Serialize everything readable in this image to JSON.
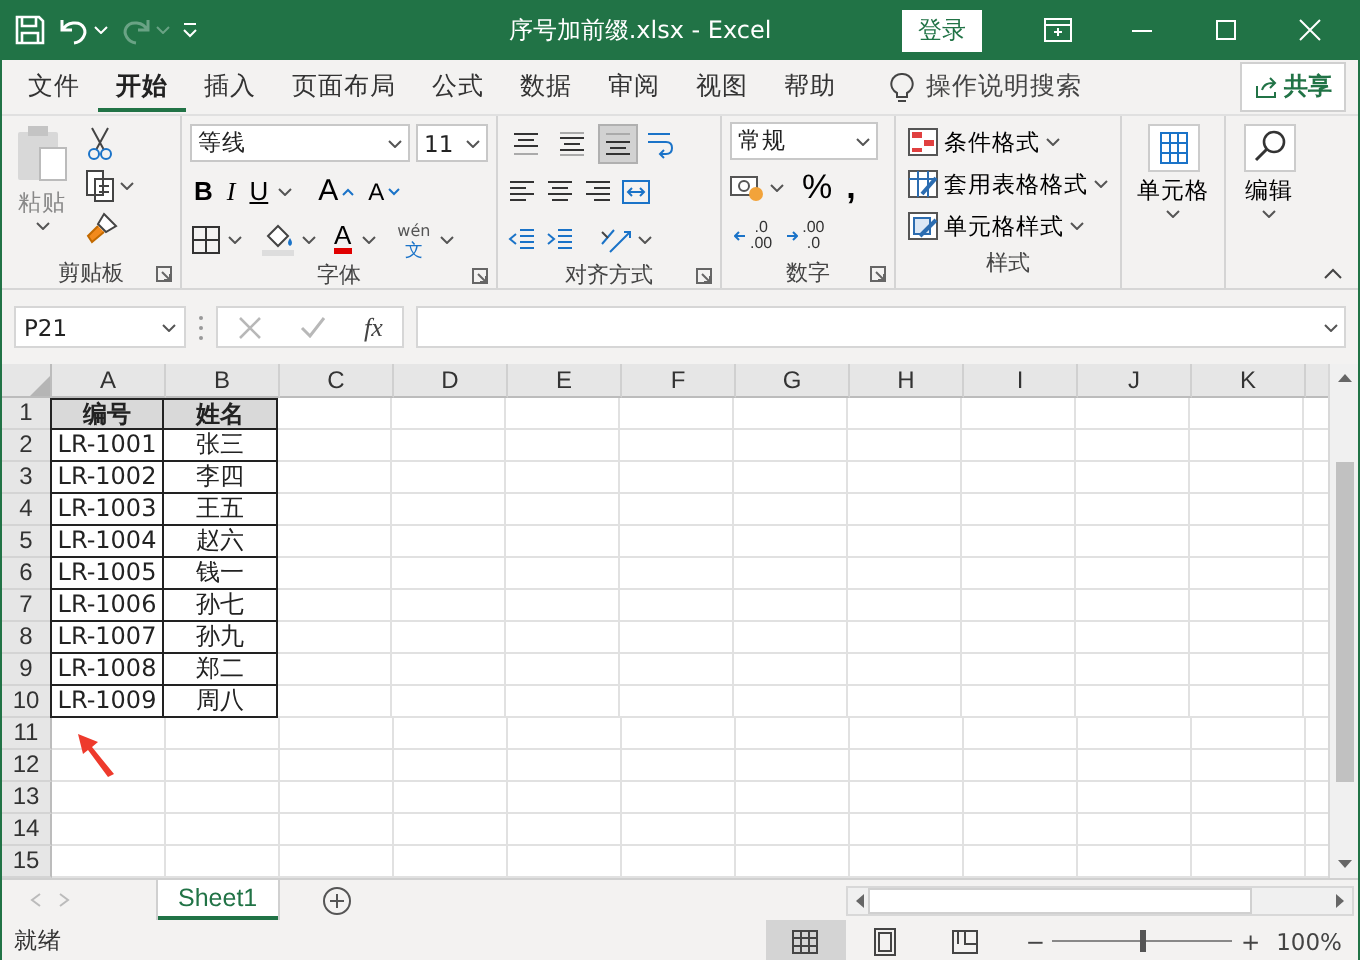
{
  "title_bar": {
    "title": "序号加前缀.xlsx  -  Excel",
    "login": "登录"
  },
  "quick_access": [
    {
      "kind": "save",
      "disabled": false
    },
    {
      "kind": "undo",
      "disabled": false
    },
    {
      "kind": "redo",
      "disabled": true
    }
  ],
  "menu_tabs": [
    {
      "label": "文件",
      "selected": false
    },
    {
      "label": "开始",
      "selected": true
    },
    {
      "label": "插入",
      "selected": false
    },
    {
      "label": "页面布局",
      "selected": false
    },
    {
      "label": "公式",
      "selected": false
    },
    {
      "label": "数据",
      "selected": false
    },
    {
      "label": "审阅",
      "selected": false
    },
    {
      "label": "视图",
      "selected": false
    },
    {
      "label": "帮助",
      "selected": false
    }
  ],
  "tell_me": "操作说明搜索",
  "share": "共享",
  "ribbon": {
    "paste": "粘贴",
    "font_name": "等线",
    "font_size": "11",
    "bold": "B",
    "italic": "I",
    "underline": "U",
    "grow_font": "A",
    "shrink_font": "A",
    "font_color": "A",
    "phonetic": [
      "wén",
      "文"
    ],
    "vertical_align": [
      {
        "kind": "top",
        "selected": false
      },
      {
        "kind": "middle",
        "selected": false
      },
      {
        "kind": "bottom",
        "selected": true
      }
    ],
    "number_format": "常规",
    "percent": "%",
    "comma": ",",
    "increase_decimal": [
      ".0",
      ".00"
    ],
    "decrease_decimal": [
      ".00",
      ".0"
    ],
    "styles": [
      {
        "kind": "conditional",
        "label": "条件格式"
      },
      {
        "kind": "table",
        "label": "套用表格格式"
      },
      {
        "kind": "cell",
        "label": "单元格样式"
      }
    ],
    "cells": "单元格",
    "editing": "编辑",
    "groups": [
      "剪贴板",
      "字体",
      "对齐方式",
      "数字",
      "样式"
    ]
  },
  "formula_bar": {
    "name_box": "P21",
    "fx": "fx",
    "buttons": [
      {
        "kind": "cancel",
        "disabled": true
      },
      {
        "kind": "enter",
        "disabled": true
      }
    ]
  },
  "columns": [
    "A",
    "B",
    "C",
    "D",
    "E",
    "F",
    "G",
    "H",
    "I",
    "J",
    "K"
  ],
  "rows": [
    {
      "number": "1",
      "kind": "header",
      "cells": [
        "编号",
        "姓名"
      ]
    },
    {
      "number": "2",
      "kind": "data",
      "cells": [
        "LR-1001",
        "张三"
      ]
    },
    {
      "number": "3",
      "kind": "data",
      "cells": [
        "LR-1002",
        "李四"
      ]
    },
    {
      "number": "4",
      "kind": "data",
      "cells": [
        "LR-1003",
        "王五"
      ]
    },
    {
      "number": "5",
      "kind": "data",
      "cells": [
        "LR-1004",
        "赵六"
      ]
    },
    {
      "number": "6",
      "kind": "data",
      "cells": [
        "LR-1005",
        "钱一"
      ]
    },
    {
      "number": "7",
      "kind": "data",
      "cells": [
        "LR-1006",
        "孙七"
      ]
    },
    {
      "number": "8",
      "kind": "data",
      "cells": [
        "LR-1007",
        "孙九"
      ]
    },
    {
      "number": "9",
      "kind": "data",
      "cells": [
        "LR-1008",
        "郑二"
      ]
    },
    {
      "number": "10",
      "kind": "data",
      "cells": [
        "LR-1009",
        "周八"
      ]
    },
    {
      "number": "11",
      "kind": "empty",
      "cells": []
    },
    {
      "number": "12",
      "kind": "empty",
      "cells": []
    },
    {
      "number": "13",
      "kind": "empty",
      "cells": []
    },
    {
      "number": "14",
      "kind": "empty",
      "cells": []
    },
    {
      "number": "15",
      "kind": "empty",
      "cells": []
    }
  ],
  "sheet_tabs": [
    {
      "label": "Sheet1",
      "selected": true
    }
  ],
  "status": "就绪",
  "view_buttons": [
    {
      "kind": "normal",
      "selected": true
    },
    {
      "kind": "page_layout",
      "selected": false
    },
    {
      "kind": "page_break",
      "selected": false
    }
  ],
  "zoom": {
    "level": 0.5,
    "minus": "−",
    "plus": "+",
    "reading": "100%"
  }
}
